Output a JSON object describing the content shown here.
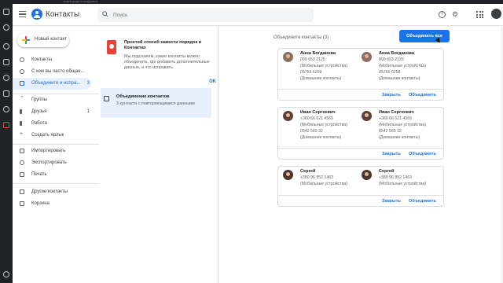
{
  "browser": {
    "url": "contacts.google.com/suggestions"
  },
  "header": {
    "app_title": "Контакты",
    "search_placeholder": "Поиск"
  },
  "sidebar": {
    "new_contact": "Новый контакт",
    "items": [
      {
        "label": "Контакты",
        "count": ""
      },
      {
        "label": "С кем вы часто общае...",
        "count": ""
      },
      {
        "label": "Объедините и испра...",
        "count": "3"
      }
    ],
    "groups_label": "Группы",
    "groups": [
      {
        "label": "Друзья",
        "count": "1"
      },
      {
        "label": "Работа",
        "count": ""
      },
      {
        "label": "Создать ярлык",
        "count": ""
      }
    ],
    "tools": [
      {
        "label": "Импортировать"
      },
      {
        "label": "Экспортировать"
      },
      {
        "label": "Печать"
      }
    ],
    "other": [
      {
        "label": "Другие контакты"
      },
      {
        "label": "Корзина"
      }
    ]
  },
  "tip": {
    "title": "Простой способ навести порядок в Контактах",
    "text": "Мы подскажем, какие контакты можно объединить, где добавить дополнительные данные, а что исправить.",
    "ok": "OK"
  },
  "suggestion": {
    "title": "Объединение контактов",
    "subtitle": "3 контакта с повторяющимися данными"
  },
  "merge": {
    "heading": "Объедините контакты (3)",
    "merge_all": "Объединить все",
    "dismiss": "Закрыть",
    "merge": "Объединить",
    "pairs": [
      {
        "left": {
          "name": "Анна Богданова",
          "lines": [
            "099 653 2125",
            "(Мобильные устройства)",
            "05755 6258",
            "(Домашние контакты)"
          ]
        },
        "right": {
          "name": "Анна Богданова",
          "lines": [
            "099 653 2125",
            "(Мобильные устройства)",
            "05755 6258",
            "(Домашние контакты)"
          ]
        }
      },
      {
        "left": {
          "name": "Иван Сергеевич",
          "lines": [
            "+380 66 521 4565",
            "(Мобильные устройства)",
            "0542 565 32",
            "(Домашние контакты)"
          ]
        },
        "right": {
          "name": "Иван Сергеевич",
          "lines": [
            "+380 66 521 4565",
            "(Мобильные устройства)",
            "0542 565 32",
            "(Домашние контакты)"
          ]
        }
      },
      {
        "left": {
          "name": "Сергей",
          "lines": [
            "+380 96 852 1463",
            "(Мобильные устройства)"
          ]
        },
        "right": {
          "name": "Сергей",
          "lines": [
            "+380 96 852 1463",
            "(Мобильные устройства)"
          ]
        }
      }
    ]
  },
  "colors": {
    "accent": "#1a73e8",
    "active_bg": "#e8f0fe",
    "rail": "#1f2227"
  }
}
